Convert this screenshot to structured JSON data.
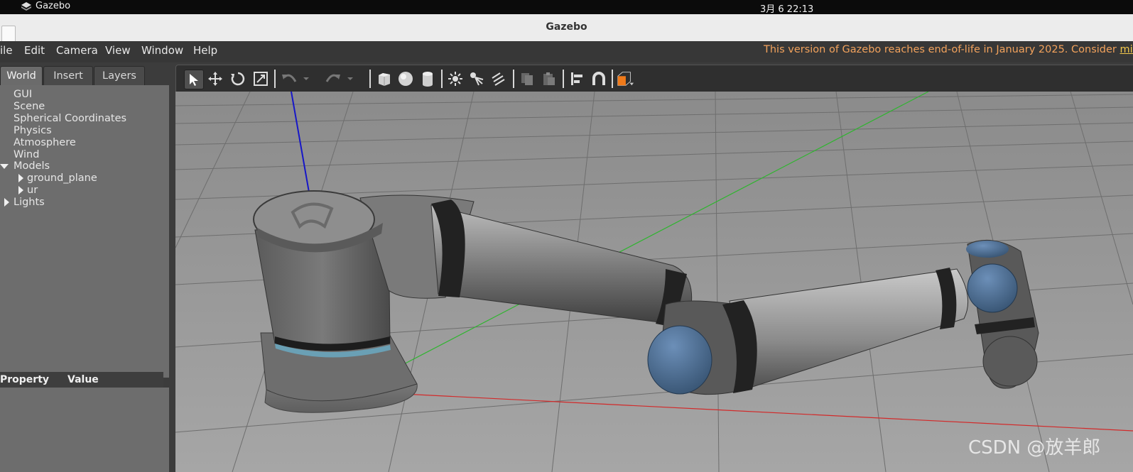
{
  "system_bar": {
    "app_name": "Gazebo",
    "clock": "3月 6  22:13"
  },
  "window": {
    "title": "Gazebo"
  },
  "menu": {
    "items": [
      "ile",
      "Edit",
      "Camera",
      "View",
      "Window",
      "Help"
    ],
    "notice_text": "This version of Gazebo reaches end-of-life in January 2025. Consider ",
    "notice_link": "migratin"
  },
  "tabs": [
    "World",
    "Insert",
    "Layers"
  ],
  "tree": {
    "items": [
      "GUI",
      "Scene",
      "Spherical Coordinates",
      "Physics",
      "Atmosphere",
      "Wind"
    ],
    "models_label": "Models",
    "model_children": [
      "ground_plane",
      "ur"
    ],
    "lights_label": "Lights"
  },
  "properties": {
    "col_property": "Property",
    "col_value": "Value"
  },
  "toolbar": {
    "tools": [
      "select-mode-icon",
      "translate-mode-icon",
      "rotate-mode-icon",
      "scale-mode-icon",
      "undo-icon",
      "undo-dropdown-icon",
      "redo-icon",
      "redo-dropdown-icon",
      "box-shape-icon",
      "sphere-shape-icon",
      "cylinder-shape-icon",
      "point-light-icon",
      "spot-light-icon",
      "directional-light-icon",
      "copy-icon",
      "paste-icon",
      "align-icon",
      "snap-icon",
      "view-angle-icon"
    ]
  },
  "colors": {
    "notice": "#f2a25c",
    "link": "#f2c84b",
    "accent_orange": "#f07a1a",
    "joint_cap_blue": "#4a6f99"
  },
  "watermark": "CSDN @放羊郎"
}
